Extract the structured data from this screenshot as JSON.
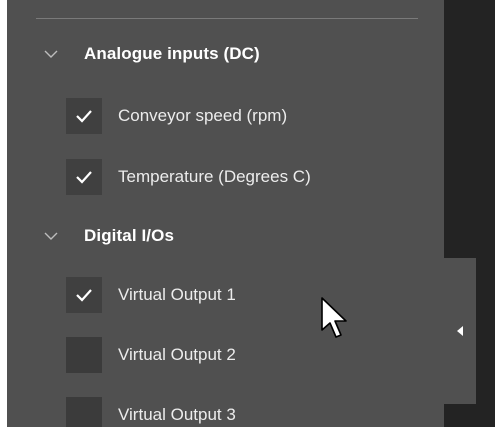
{
  "groups": [
    {
      "label": "Analogue inputs (DC)",
      "expanded": true,
      "items": [
        {
          "label": "Conveyor speed (rpm)",
          "checked": true
        },
        {
          "label": "Temperature (Degrees C)",
          "checked": true
        }
      ]
    },
    {
      "label": "Digital I/Os",
      "expanded": true,
      "items": [
        {
          "label": "Virtual Output 1",
          "checked": true
        },
        {
          "label": "Virtual Output 2",
          "checked": false
        },
        {
          "label": "Virtual Output 3",
          "checked": false
        }
      ]
    }
  ],
  "icons": {
    "group_toggle": "chevron-down-icon",
    "checkbox_mark": "checkmark-icon",
    "collapse_tab": "caret-left-icon",
    "pointer": "mouse-cursor-icon"
  },
  "colors": {
    "panel_bg": "#505050",
    "checkbox_bg": "#3b3b3b",
    "text": "#ffffff",
    "outer_bg": "#232323"
  }
}
